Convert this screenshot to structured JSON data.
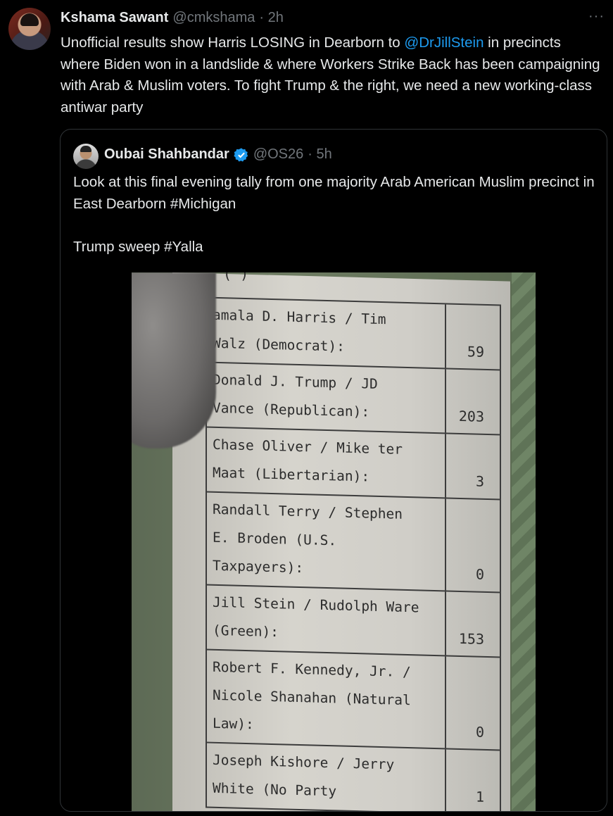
{
  "tweet": {
    "author_name": "Kshama Sawant",
    "author_handle": "@cmkshama",
    "time": "· 2h",
    "more_icon": "···",
    "text_before": "Unofficial results show Harris LOSING in Dearborn to ",
    "mention": "@DrJillStein",
    "text_after": " in precincts where Biden won in a landslide & where Workers Strike Back has been campaigning with Arab & Muslim voters. To fight Trump & the right, we need a new working-class antiwar party"
  },
  "quote": {
    "author_name": "Oubai Shahbandar",
    "author_handle": "@OS26",
    "time": "· 5h",
    "text": "Look at this final evening tally from one majority Arab American  Muslim precinct in East Dearborn #Michigan\n\nTrump sweep #Yalla"
  },
  "photo": {
    "top_mark": "( )",
    "rows": [
      {
        "line1": "amala D. Harris / Tim",
        "line2": "Walz (Democrat):",
        "line3": "",
        "votes": "59"
      },
      {
        "line1": "Donald J. Trump / JD",
        "line2": "Vance (Republican):",
        "line3": "",
        "votes": "203"
      },
      {
        "line1": "Chase Oliver / Mike ter",
        "line2": "Maat (Libertarian):",
        "line3": "",
        "votes": "3"
      },
      {
        "line1": "Randall Terry / Stephen",
        "line2": "E. Broden (U.S.",
        "line3": "Taxpayers):",
        "votes": "0"
      },
      {
        "line1": "Jill Stein / Rudolph Ware",
        "line2": "(Green):",
        "line3": "",
        "votes": "153"
      },
      {
        "line1": "Robert F. Kennedy, Jr. /",
        "line2": "Nicole Shanahan (Natural",
        "line3": "Law):",
        "votes": "0"
      },
      {
        "line1": "Joseph Kishore / Jerry",
        "line2": "White (No Party",
        "line3": "",
        "votes": "1"
      }
    ]
  },
  "colors": {
    "background": "#000000",
    "text": "#e7e9ea",
    "muted": "#71767b",
    "link": "#1d9bf0",
    "border": "#2f3336"
  }
}
